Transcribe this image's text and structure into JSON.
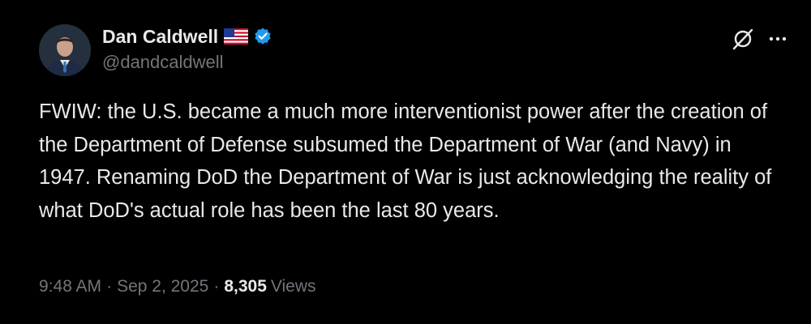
{
  "author": {
    "display_name": "Dan Caldwell",
    "handle": "@dandcaldwell"
  },
  "icons": {
    "flag": "us-flag-icon",
    "verified": "verified-badge-icon",
    "grok": "grok-icon",
    "more": "more-options-icon"
  },
  "tweet": {
    "text": "FWIW: the U.S. became a much more interventionist power after the creation of the Department of Defense subsumed the Department of War (and Navy) in 1947. Renaming DoD the Department of War is just acknowledging the reality of what DoD's actual role has been the last 80 years."
  },
  "meta": {
    "time": "9:48 AM",
    "separator": "·",
    "date": "Sep 2, 2025",
    "views_count": "8,305",
    "views_label": "Views"
  },
  "colors": {
    "background": "#000000",
    "primary_text": "#e7e9ea",
    "secondary_text": "#71767b",
    "verified_blue": "#1d9bf0"
  }
}
